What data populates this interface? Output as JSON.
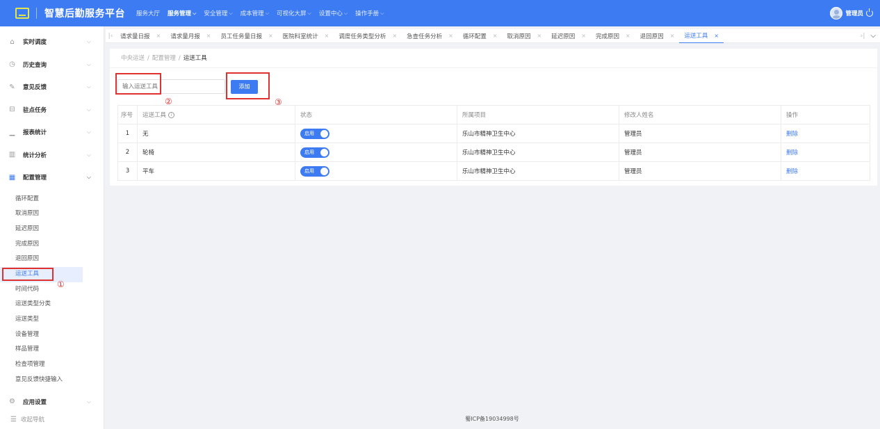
{
  "header": {
    "app_title": "智慧后勤服务平台",
    "nav": [
      {
        "label": "服务大厅",
        "has_menu": false,
        "active": false
      },
      {
        "label": "服务管理",
        "has_menu": true,
        "active": true
      },
      {
        "label": "安全管理",
        "has_menu": true,
        "active": false
      },
      {
        "label": "成本管理",
        "has_menu": true,
        "active": false
      },
      {
        "label": "可视化大屏",
        "has_menu": true,
        "active": false
      },
      {
        "label": "设置中心",
        "has_menu": true,
        "active": false
      },
      {
        "label": "操作手册",
        "has_menu": true,
        "active": false
      }
    ],
    "user_name": "管理员"
  },
  "sidebar": {
    "groups": [
      {
        "label": "实时调度",
        "icon": "home-icon"
      },
      {
        "label": "历史查询",
        "icon": "history-icon"
      },
      {
        "label": "意见反馈",
        "icon": "feedback-icon"
      },
      {
        "label": "驻点任务",
        "icon": "task-icon"
      },
      {
        "label": "报表统计",
        "icon": "report-icon"
      },
      {
        "label": "统计分析",
        "icon": "analysis-icon"
      },
      {
        "label": "配置管理",
        "icon": "grid-icon"
      }
    ],
    "sub_items": [
      "循环配置",
      "取消原因",
      "延迟原因",
      "完成原因",
      "退回原因",
      "运送工具",
      "时间代码",
      "运送类型分类",
      "运送类型",
      "设备管理",
      "样品管理",
      "检查项管理",
      "意见反馈快捷输入"
    ],
    "active_sub": "运送工具",
    "after_group": {
      "label": "应用设置",
      "icon": "settings-icon"
    },
    "collapse_label": "收起导航"
  },
  "tabs": [
    "请求量日报",
    "请求量月报",
    "员工任务量日报",
    "医院科室统计",
    "调度任务类型分析",
    "急查任务分析",
    "循环配置",
    "取消原因",
    "延迟原因",
    "完成原因",
    "退回原因",
    "运送工具"
  ],
  "active_tab": "运送工具",
  "breadcrumb": [
    "中央运送",
    "配置管理",
    "运送工具"
  ],
  "form": {
    "placeholder": "输入运送工具",
    "add_label": "添加"
  },
  "table": {
    "headers": [
      "序号",
      "运送工具",
      "状态",
      "所属项目",
      "修改人姓名",
      "操作"
    ],
    "rows": [
      {
        "idx": "1",
        "tool": "无",
        "status": "启用",
        "project": "乐山市精神卫生中心",
        "editor": "管理员",
        "action": "删除"
      },
      {
        "idx": "2",
        "tool": "轮椅",
        "status": "启用",
        "project": "乐山市精神卫生中心",
        "editor": "管理员",
        "action": "删除"
      },
      {
        "idx": "3",
        "tool": "平车",
        "status": "启用",
        "project": "乐山市精神卫生中心",
        "editor": "管理员",
        "action": "删除"
      }
    ]
  },
  "annotations": [
    "①",
    "②",
    "③"
  ],
  "footer": "蜀ICP备19034998号",
  "colors": {
    "primary": "#3d7bf3",
    "annotation": "#e03131",
    "logo_accent": "#e2e64a"
  }
}
